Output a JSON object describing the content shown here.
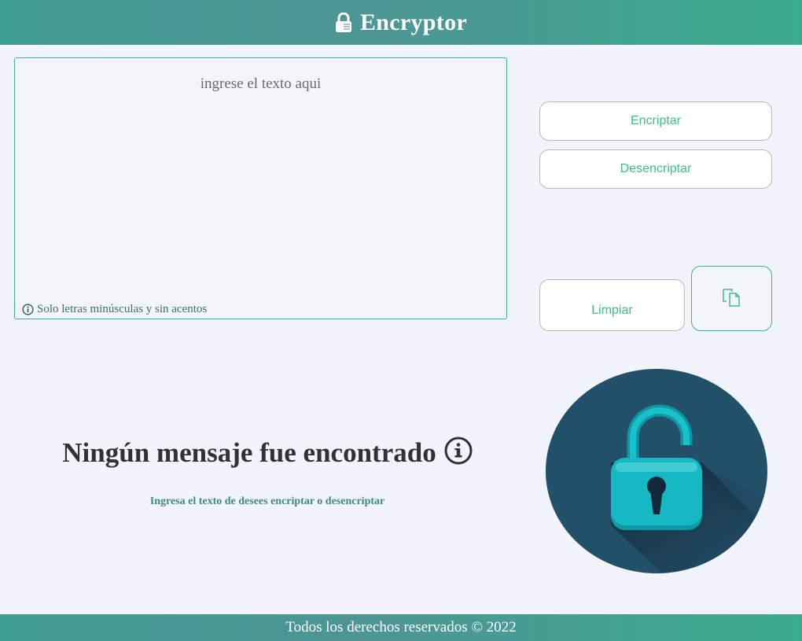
{
  "header": {
    "title": "Encryptor",
    "icon": "lock-icon"
  },
  "input": {
    "placeholder": "ingrese el texto aqui",
    "value": "",
    "hint": "Solo letras minúsculas y sin acentos",
    "hint_icon": "info-icon"
  },
  "actions": {
    "encrypt_label": "Encriptar",
    "decrypt_label": "Desencriptar",
    "clear_label": "Limpiar",
    "copy_icon": "copy-icon"
  },
  "output": {
    "title": "Ningún mensaje fue encontrado",
    "title_icon": "info-icon",
    "subtitle": "Ingresa el texto de desees encriptar o desencriptar",
    "illustration": "open-padlock-illustration"
  },
  "footer": {
    "text": "Todos los derechos reservados © 2022"
  },
  "colors": {
    "accent": "#3fbf80",
    "header_bg": "#4e9595",
    "page_bg": "#f2f4fb",
    "dark_text": "#2f3338",
    "padlock": "#14b6c0",
    "circle": "#235069"
  }
}
